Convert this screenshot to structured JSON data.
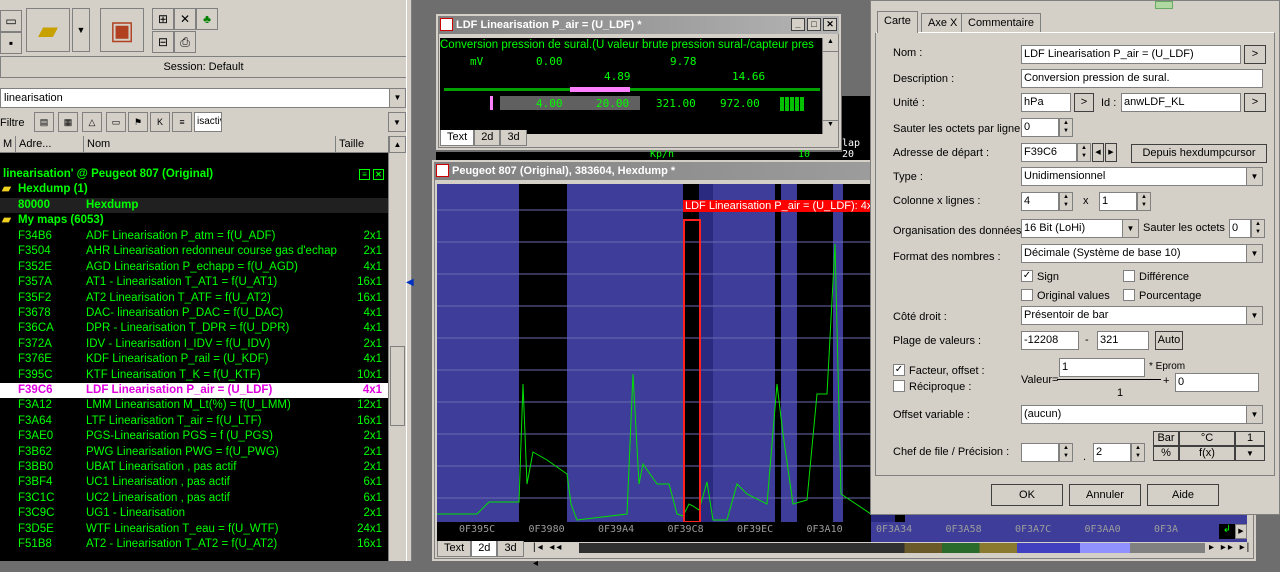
{
  "left": {
    "session": "Session: Default",
    "search_value": "linearisation",
    "filter_label": "Filtre",
    "filter_text": "isactiv",
    "columns": [
      "M",
      "Adre...",
      "Nom",
      "Taille"
    ],
    "tree_title": "linearisation' @ Peugeot 807 (Original)",
    "hexdump_group": "Hexdump (1)",
    "hexdump_row": {
      "addr": "80000",
      "name": "Hexdump"
    },
    "maps_group": "My maps (6053)",
    "rows": [
      {
        "addr": "F34B6",
        "name": "ADF Linearisation  P_atm = f(U_ADF)",
        "size": "2x1"
      },
      {
        "addr": "F3504",
        "name": "AHR Linearisation redonneur course gas d'echap",
        "size": "2x1"
      },
      {
        "addr": "F352E",
        "name": "AGD Linearisation  P_echapp = f(U_AGD)",
        "size": "4x1"
      },
      {
        "addr": "F357A",
        "name": "AT1 - Linearisation  T_AT1 = f(U_AT1)",
        "size": "16x1"
      },
      {
        "addr": "F35F2",
        "name": "AT2 Linearisation  T_ATF = f(U_AT2)",
        "size": "16x1"
      },
      {
        "addr": "F3678",
        "name": "DAC- linearisation P_DAC = f(U_DAC)",
        "size": "4x1"
      },
      {
        "addr": "F36CA",
        "name": "DPR - Linearisation  T_DPR = f(U_DPR)",
        "size": "4x1"
      },
      {
        "addr": "F372A",
        "name": "IDV - Linearisation     I_IDV = f(U_IDV)",
        "size": "2x1"
      },
      {
        "addr": "F376E",
        "name": "KDF Linearisation  P_rail = (U_KDF)",
        "size": "4x1"
      },
      {
        "addr": "F395C",
        "name": "KTF Linearisation  T_K = f(U_KTF)",
        "size": "10x1"
      },
      {
        "addr": "F39C6",
        "name": "LDF Linearisation  P_air = (U_LDF)",
        "size": "4x1",
        "selected": true
      },
      {
        "addr": "F3A12",
        "name": "LMM Linearisation  M_Lt(%) = f(U_LMM)",
        "size": "12x1"
      },
      {
        "addr": "F3A64",
        "name": "LTF Linearisation  T_air = f(U_LTF)",
        "size": "16x1"
      },
      {
        "addr": "F3AE0",
        "name": "PGS-Linearisation PGS = f (U_PGS)",
        "size": "2x1"
      },
      {
        "addr": "F3B62",
        "name": "PWG Linearisation  PWG = f(U_PWG)",
        "size": "2x1"
      },
      {
        "addr": "F3BB0",
        "name": "UBAT Linearisation , pas actif",
        "size": "2x1"
      },
      {
        "addr": "F3BF4",
        "name": "UC1 Linearisation , pas actif",
        "size": "6x1"
      },
      {
        "addr": "F3C1C",
        "name": "UC2 Linearisation , pas actif",
        "size": "6x1"
      },
      {
        "addr": "F3C9C",
        "name": "UG1 - Linearisation",
        "size": "2x1"
      },
      {
        "addr": "F3D5E",
        "name": "WTF Linearisation  T_eau = f(U_WTF)",
        "size": "24x1"
      },
      {
        "addr": "F51B8",
        "name": "AT2 - Linearisation  T_AT2 = f(U_AT2)",
        "size": "16x1"
      }
    ]
  },
  "ldf_window": {
    "title": "LDF Linearisation  P_air = (U_LDF) *",
    "description": "Conversion pression de sural.(U valeur brute pression sural-/capteur pres",
    "unit_x": "mV",
    "x_top": [
      "0.00",
      "9.78"
    ],
    "x_mid": [
      "4.89",
      "14.66"
    ],
    "values": [
      "4.00",
      "20.00",
      "321.00",
      "972.00"
    ],
    "tabs": [
      "Text",
      "2d",
      "3d"
    ]
  },
  "hex_window": {
    "title": "Peugeot 807 (Original), 383604, Hexdump *",
    "map_label": "LDF Linearisation  P_air = (U_LDF): 4x1",
    "addresses": [
      "0F395C",
      "0F3980",
      "0F39A4",
      "0F39C8",
      "0F39EC",
      "0F3A10",
      "0F3A34",
      "0F3A58",
      "0F3A7C",
      "0F3AA0",
      "0F3A"
    ],
    "tabs": [
      "Text",
      "2d",
      "3d"
    ],
    "behind_text": "Kp/n",
    "behind_num": "10",
    "behind_right": "lap 20"
  },
  "dialog": {
    "tabs": [
      "Carte",
      "Axe X",
      "Commentaire"
    ],
    "nom_label": "Nom :",
    "nom_value": "LDF Linearisation  P_air = (U_LDF)",
    "desc_label": "Description :",
    "desc_value": "Conversion pression de sural.",
    "unit_label": "Unité :",
    "unit_value": "hPa",
    "id_label": "Id :",
    "id_value": "anwLDF_KL",
    "skip_label": "Sauter les octets par ligne :",
    "skip_value": "0",
    "addr_label": "Adresse de départ :",
    "addr_value": "F39C6",
    "hexcursor_button": "Depuis hexdumpcursor",
    "type_label": "Type :",
    "type_value": "Unidimensionnel",
    "cols_label": "Colonne x lignes :",
    "cols_value": "4",
    "x_sep": "x",
    "rows_value": "1",
    "org_label": "Organisation des données :",
    "org_value": "16 Bit (LoHi)",
    "skip2_label": "Sauter les octets :",
    "skip2_value": "0",
    "fmt_label": "Format des nombres :",
    "fmt_value": "Décimale (Système de base 10)",
    "sign_label": "Sign",
    "diff_label": "Différence",
    "orig_label": "Original values",
    "pct_label": "Pourcentage",
    "right_label": "Côté droit :",
    "right_value": "Présentoir de bar",
    "range_label": "Plage de valeurs :",
    "range_min": "-12208",
    "range_dash": "-",
    "range_max": "321",
    "auto_button": "Auto",
    "factor_label": "Facteur, offset :",
    "recip_label": "Réciproque :",
    "valeur_label": "Valeur=",
    "factor_num": "1",
    "eprom_label": "* Eprom",
    "factor_den": "1",
    "plus": "+",
    "offset_value": "0",
    "offvar_label": "Offset variable :",
    "offvar_value": "(aucun)",
    "prec_label": "Chef de file / Précision :",
    "prec_value": "2",
    "prec_dot": ".",
    "bar_button": "Bar",
    "degc_button": "°C",
    "one_button": "1",
    "pct_button": "%",
    "fx_button": "f(x)",
    "ok_button": "OK",
    "cancel_button": "Annuler",
    "help_button": "Aide"
  }
}
